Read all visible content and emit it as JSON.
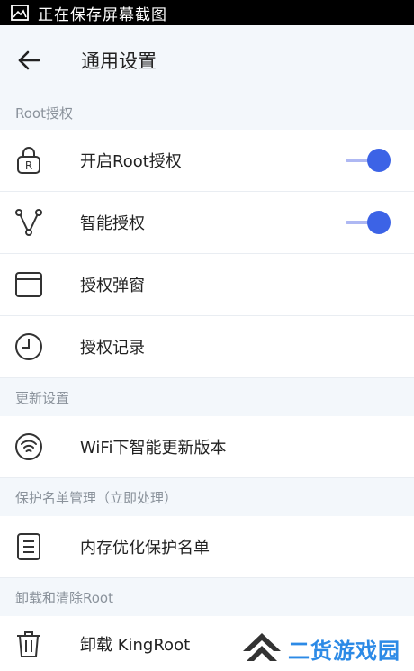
{
  "status_bar": {
    "text": "正在保存屏幕截图",
    "icon": "image-icon"
  },
  "app_bar": {
    "title": "通用设置",
    "back_icon": "arrow-left-icon"
  },
  "sections": [
    {
      "header": "Root授权"
    },
    {
      "header": "更新设置"
    },
    {
      "header": "保护名单管理（立即处理）"
    },
    {
      "header": "卸载和清除Root"
    }
  ],
  "items": [
    {
      "label": "开启Root授权",
      "icon": "root-lock-icon",
      "toggle": true
    },
    {
      "label": "智能授权",
      "icon": "nodes-icon",
      "toggle": true
    },
    {
      "label": "授权弹窗",
      "icon": "window-icon"
    },
    {
      "label": "授权记录",
      "icon": "clock-icon"
    },
    {
      "label": "WiFi下智能更新版本",
      "icon": "wifi-icon"
    },
    {
      "label": "内存优化保护名单",
      "icon": "document-icon"
    },
    {
      "label": "卸载 KingRoot",
      "icon": "trash-icon"
    }
  ],
  "watermark": {
    "text": "二货游戏园"
  },
  "colors": {
    "accent": "#3c63e6",
    "toggle_track": "#aeb8f3",
    "background": "#f3f7fb",
    "watermark": "#2c8ae6"
  }
}
